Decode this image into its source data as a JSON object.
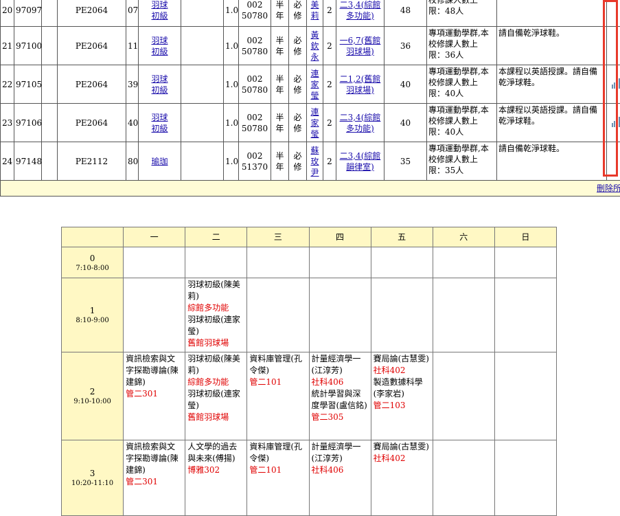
{
  "courses": [
    {
      "no": "20",
      "id": "97097",
      "code": "PE2064",
      "cls": "07",
      "name": [
        "羽球",
        "初級"
      ],
      "credit": "1.0",
      "serial": [
        "002",
        "50780"
      ],
      "term": [
        "半",
        "年"
      ],
      "req": [
        "必",
        "修"
      ],
      "teacher": [
        "美",
        "莉"
      ],
      "hours": "2",
      "time": [
        "二3,4(綜館",
        "多功能)"
      ],
      "cap": "48",
      "limit": [
        "校修課人數上",
        "限：48人"
      ],
      "note": "",
      "has_icon": false
    },
    {
      "no": "21",
      "id": "97100",
      "code": "PE2064",
      "cls": "11",
      "name": [
        "羽球",
        "初級"
      ],
      "credit": "1.0",
      "serial": [
        "002",
        "50780"
      ],
      "term": [
        "半",
        "年"
      ],
      "req": [
        "必",
        "修"
      ],
      "teacher": [
        "黃",
        "欽",
        "永"
      ],
      "hours": "2",
      "time": [
        "一6,7(舊館",
        "羽球場)"
      ],
      "cap": "36",
      "limit": [
        "專項運動學群,本",
        "校修課人數上",
        "限：36人"
      ],
      "note": "請自備乾淨球鞋。",
      "has_icon": false
    },
    {
      "no": "22",
      "id": "97105",
      "code": "PE2064",
      "cls": "39",
      "name": [
        "羽球",
        "初級"
      ],
      "credit": "1.0",
      "serial": [
        "002",
        "50780"
      ],
      "term": [
        "半",
        "年"
      ],
      "req": [
        "必",
        "修"
      ],
      "teacher": [
        "連",
        "家",
        "瑩"
      ],
      "hours": "2",
      "time": [
        "二1,2(舊館",
        "羽球場)"
      ],
      "cap": "40",
      "limit": [
        "專項運動學群,本",
        "校修課人數上",
        "限：40人"
      ],
      "note": "本課程以英語授課。請自備乾淨球鞋。",
      "has_icon": true
    },
    {
      "no": "23",
      "id": "97106",
      "code": "PE2064",
      "cls": "40",
      "name": [
        "羽球",
        "初級"
      ],
      "credit": "1.0",
      "serial": [
        "002",
        "50780"
      ],
      "term": [
        "半",
        "年"
      ],
      "req": [
        "必",
        "修"
      ],
      "teacher": [
        "連",
        "家",
        "瑩"
      ],
      "hours": "2",
      "time": [
        "二3,4(綜館",
        "多功能)"
      ],
      "cap": "40",
      "limit": [
        "專項運動學群,本",
        "校修課人數上",
        "限：40人"
      ],
      "note": "本課程以英語授課。請自備乾淨球鞋。",
      "has_icon": true
    },
    {
      "no": "24",
      "id": "97148",
      "code": "PE2112",
      "cls": "80",
      "name": [
        "瑜珈"
      ],
      "credit": "1.0",
      "serial": [
        "002",
        "51370"
      ],
      "term": [
        "半",
        "年"
      ],
      "req": [
        "必",
        "修"
      ],
      "teacher": [
        "蘇",
        "玫",
        "尹"
      ],
      "hours": "2",
      "time": [
        "二3,4(綜館",
        "韻律室)"
      ],
      "cap": "35",
      "limit": [
        "專項運動學群,本",
        "校修課人數上",
        "限：35人"
      ],
      "note": "請自備乾淨球鞋。",
      "has_icon": false
    }
  ],
  "delete_label": [
    "刪",
    "除"
  ],
  "delete_all_label": "刪除所有記錄",
  "timetable": {
    "days": [
      "一",
      "二",
      "三",
      "四",
      "五",
      "六",
      "日"
    ],
    "periods": [
      {
        "num": "0",
        "time": "7:10-8:00",
        "cells": [
          [],
          [],
          [],
          [],
          [],
          [],
          []
        ]
      },
      {
        "num": "1",
        "time": "8:10-9:00",
        "cells": [
          [],
          [
            {
              "t": "羽球初級(陳美莉)",
              "r": false
            },
            {
              "t": "綜館多功能",
              "r": true
            },
            {
              "t": "羽球初級(連家瑩)",
              "r": false
            },
            {
              "t": "舊館羽球場",
              "r": true
            }
          ],
          [],
          [],
          [],
          [],
          []
        ]
      },
      {
        "num": "2",
        "time": "9:10-10:00",
        "cells": [
          [
            {
              "t": "資訊檢索與文字探勘導論(陳建錦)",
              "r": false
            },
            {
              "t": "管二301",
              "r": true
            }
          ],
          [
            {
              "t": "羽球初級(陳美莉)",
              "r": false
            },
            {
              "t": "綜館多功能",
              "r": true
            },
            {
              "t": "羽球初級(連家瑩)",
              "r": false
            },
            {
              "t": "舊館羽球場",
              "r": true
            }
          ],
          [
            {
              "t": "資料庫管理(孔令傑)",
              "r": false
            },
            {
              "t": "管二101",
              "r": true
            }
          ],
          [
            {
              "t": "計量經濟學一(江淳芳)",
              "r": false
            },
            {
              "t": "社科406",
              "r": true
            },
            {
              "t": "統計學習與深度學習(盧信銘)",
              "r": false
            },
            {
              "t": "管二305",
              "r": true
            }
          ],
          [
            {
              "t": "賽局論(古慧雯)",
              "r": false
            },
            {
              "t": "社科402",
              "r": true
            },
            {
              "t": "製造數據科學(李家岩)",
              "r": false
            },
            {
              "t": "管二103",
              "r": true
            }
          ],
          [],
          []
        ]
      },
      {
        "num": "3",
        "time": "10:20-11:10",
        "cells": [
          [
            {
              "t": "資訊檢索與文字探勘導論(陳建錦)",
              "r": false
            },
            {
              "t": "管二301",
              "r": true
            }
          ],
          [
            {
              "t": "人文學的過去與未來(傅揚)",
              "r": false
            },
            {
              "t": "博雅302",
              "r": true
            }
          ],
          [
            {
              "t": "資料庫管理(孔令傑)",
              "r": false
            },
            {
              "t": "管二101",
              "r": true
            }
          ],
          [
            {
              "t": "計量經濟學一(江淳芳)",
              "r": false
            },
            {
              "t": "社科406",
              "r": true
            }
          ],
          [
            {
              "t": "賽局論(古慧雯)",
              "r": false
            },
            {
              "t": "社科402",
              "r": true
            }
          ],
          [],
          []
        ]
      }
    ]
  },
  "colors": {
    "header_bg": "#fff8c4",
    "highlight": "#e8392a",
    "link": "#1a0dab",
    "room": "#e00000"
  }
}
